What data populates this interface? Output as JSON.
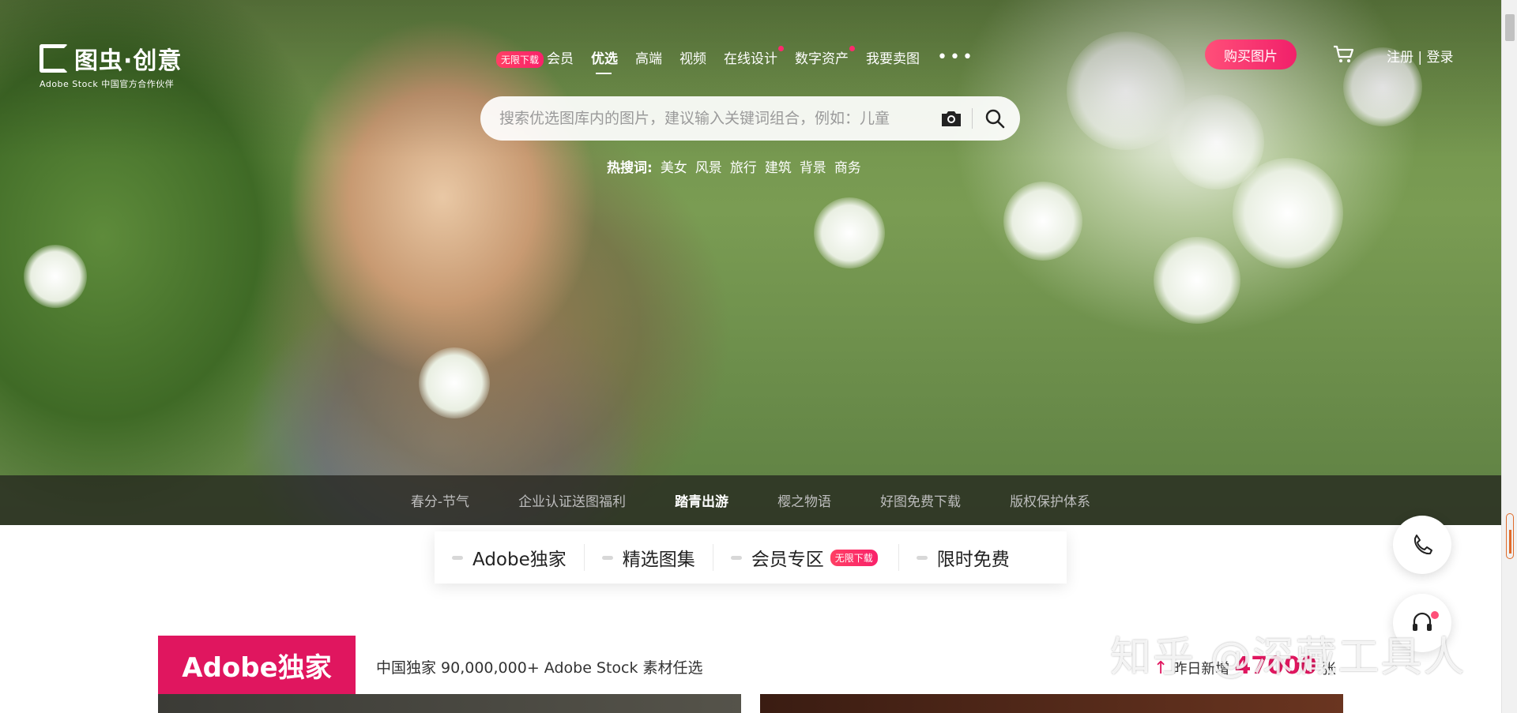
{
  "logo": {
    "name": "图虫·创意",
    "tagline": "Adobe Stock 中国官方合作伙伴"
  },
  "nav": {
    "badge": "无限下载",
    "items": [
      "会员",
      "优选",
      "高端",
      "视频",
      "在线设计",
      "数字资产",
      "我要卖图"
    ],
    "more": "•••"
  },
  "header": {
    "buy_button": "购买图片",
    "auth": "注册 | 登录"
  },
  "search": {
    "placeholder": "搜索优选图库内的图片，建议输入关键词组合，例如：儿童"
  },
  "hot": {
    "label": "热搜词:",
    "words": [
      "美女",
      "风景",
      "旅行",
      "建筑",
      "背景",
      "商务"
    ]
  },
  "subnav": {
    "items": [
      "春分-节气",
      "企业认证送图福利",
      "踏青出游",
      "樱之物语",
      "好图免费下载",
      "版权保护体系"
    ],
    "active": 2
  },
  "tabs": {
    "items": [
      "Adobe独家",
      "精选图集",
      "会员专区",
      "限时免费"
    ],
    "badge": "无限下载"
  },
  "section": {
    "title": "Adobe独家",
    "desc": "中国独家 90,000,000+ Adobe Stock 素材任选",
    "stat_label": "昨日新增",
    "stat_value": "47000",
    "stat_unit": "张"
  },
  "watermark": "知乎 @深藏工具人",
  "colors": {
    "accent": "#e0165f",
    "button": "#f1206a"
  },
  "icons": [
    "camera-icon",
    "search-icon",
    "cart-icon",
    "phone-icon",
    "headset-icon",
    "arrow-up-icon"
  ]
}
